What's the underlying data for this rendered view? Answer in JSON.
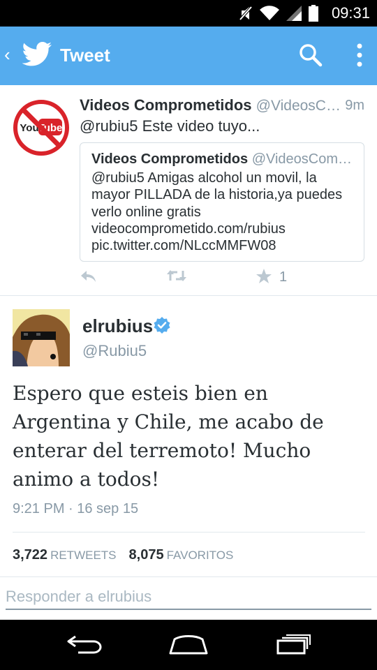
{
  "status_bar": {
    "time": "09:31"
  },
  "app_bar": {
    "title": "Tweet"
  },
  "quoting_tweet": {
    "name": "Videos Comprometidos",
    "handle": "@VideosC…",
    "time": "9m",
    "text": "@rubiu5 Este video tuyo...",
    "favorite_count": "1",
    "avatar_label": "YouTube",
    "quoted": {
      "name": "Videos Comprometidos",
      "handle": "@VideosCom…",
      "lines": [
        "@rubiu5 Amigas alcohol un movil, la",
        "mayor PILLADA de la historia,ya puedes",
        "verlo online gratis",
        "videocomprometido.com/rubius",
        "pic.twitter.com/NLccMMFW08"
      ]
    }
  },
  "main_tweet": {
    "name": "elrubius",
    "handle": "@Rubiu5",
    "text_lines": [
      "Espero que esteis bien en",
      "Argentina y Chile, me acabo de",
      "enterar del terremoto! Mucho",
      "animo a todos!"
    ],
    "date": "9:21 PM · 16 sep 15",
    "retweets": "3,722",
    "retweets_label": "RETWEETS",
    "favorites": "8,075",
    "favorites_label": "FAVORITOS"
  },
  "reply": {
    "placeholder": "Responder a elrubius"
  },
  "colors": {
    "accent": "#55acee",
    "muted": "#8899a6",
    "text": "#292f33"
  }
}
